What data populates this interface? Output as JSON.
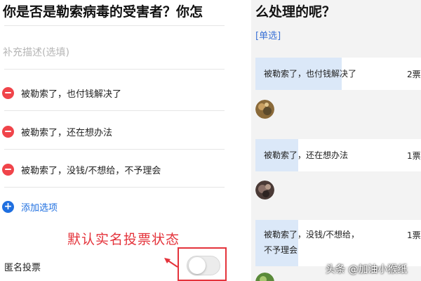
{
  "question": {
    "title_part1": "你是否是勒索病毒的受害者？你怎",
    "title_part2": "么处理的呢？",
    "description_placeholder": "补充描述(选填)"
  },
  "editor": {
    "options": [
      {
        "label": "被勒索了，也付钱解决了",
        "icon": "remove-circle-icon"
      },
      {
        "label": "被勒索了，还在想办法",
        "icon": "remove-circle-icon"
      },
      {
        "label": "被勒索了，没钱/不想给，不予理会",
        "icon": "remove-circle-icon"
      }
    ],
    "add_option_label": "添加选项",
    "add_option_icon": "add-circle-icon",
    "anonymous_label": "匿名投票",
    "anonymous_enabled": false,
    "annotation_text": "默认实名投票状态"
  },
  "poll": {
    "type_tag": "[单选]",
    "results": [
      {
        "label": "被勒索了，也付钱解决了",
        "count_text": "2票",
        "share": 0.52
      },
      {
        "label": "被勒索了，还在想办法",
        "count_text": "1票",
        "share": 0.26
      },
      {
        "label": "被勒索了，没钱/不想给，不予理会",
        "label_line1": "被勒索了，没钱/不想给，",
        "label_line2": "不予理会",
        "count_text": "1票",
        "share": 0.26
      }
    ]
  },
  "watermark": "头条 @加油小猴纸",
  "colors": {
    "remove": "#f0444a",
    "add": "#1f6fe0",
    "annotation": "#e4333b",
    "bar_fill": "#dbe8f8",
    "tag": "#3b72d6"
  }
}
